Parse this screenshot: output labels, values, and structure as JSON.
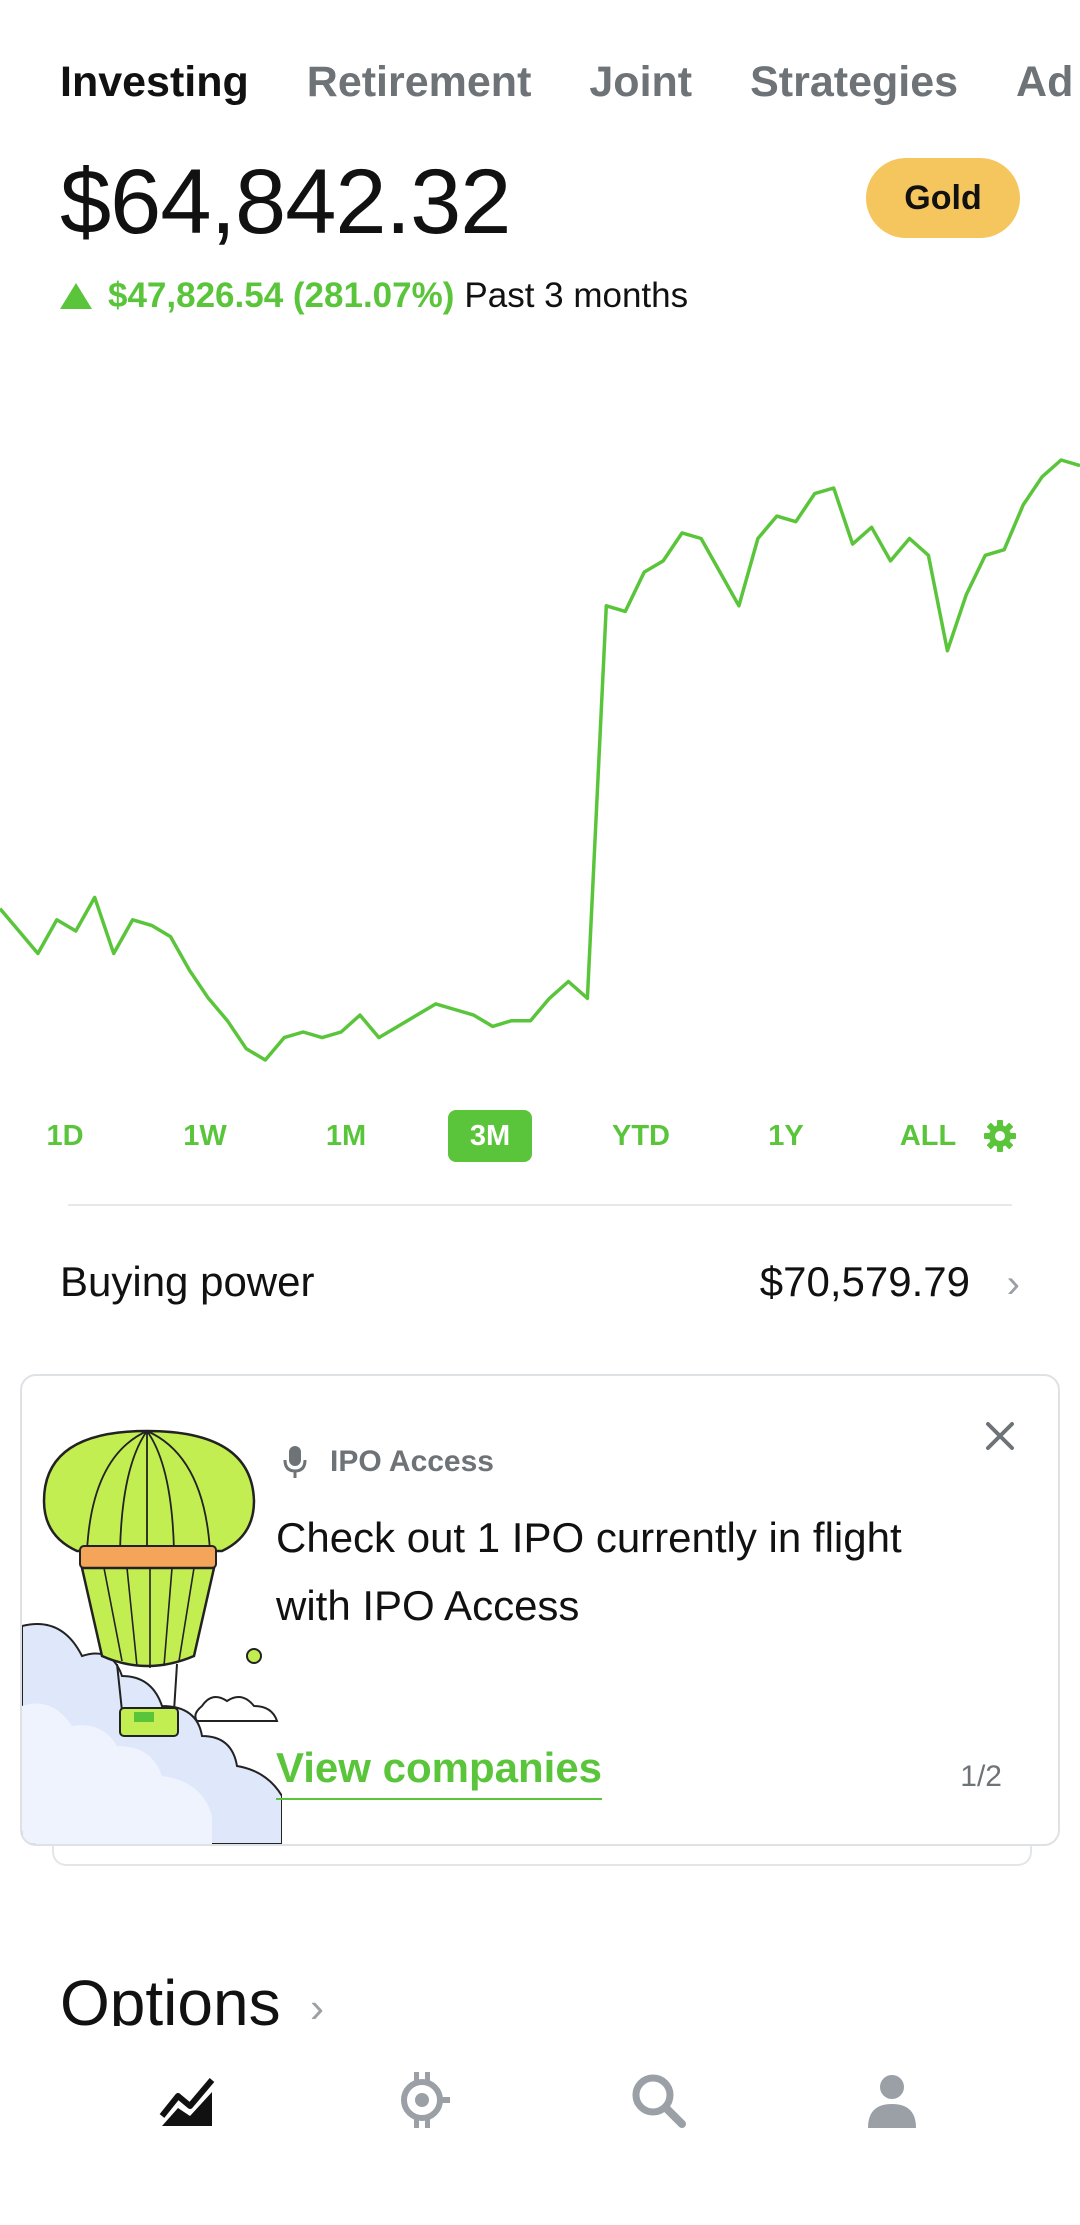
{
  "tabs": [
    {
      "label": "Investing",
      "active": true
    },
    {
      "label": "Retirement",
      "active": false
    },
    {
      "label": "Joint",
      "active": false
    },
    {
      "label": "Strategies",
      "active": false
    },
    {
      "label": "Ad",
      "active": false
    }
  ],
  "portfolio": {
    "balance": "$64,842.32",
    "badge": "Gold",
    "gain_amount": "$47,826.54 (281.07%)",
    "gain_period": "Past 3 months"
  },
  "chart_data": {
    "type": "line",
    "color": "#5ac53b",
    "grid": false,
    "values": [
      62,
      60,
      58,
      61,
      60,
      63,
      58,
      61,
      60.5,
      59.5,
      56.5,
      54,
      52,
      49.5,
      48.5,
      50.5,
      51,
      50.5,
      51,
      52.5,
      50.5,
      51.5,
      52.5,
      53.5,
      53,
      52.5,
      51.5,
      52,
      52,
      54,
      55.5,
      54,
      89,
      88.5,
      92,
      93,
      95.5,
      95,
      92,
      89,
      95,
      97,
      96.5,
      99,
      99.5,
      94.5,
      96,
      93,
      95,
      93.5,
      85,
      90,
      93.5,
      94,
      98,
      100.5,
      102,
      101.5
    ]
  },
  "ranges": [
    {
      "label": "1D",
      "active": false
    },
    {
      "label": "1W",
      "active": false
    },
    {
      "label": "1M",
      "active": false
    },
    {
      "label": "3M",
      "active": true
    },
    {
      "label": "YTD",
      "active": false
    },
    {
      "label": "1Y",
      "active": false
    },
    {
      "label": "ALL",
      "active": false
    }
  ],
  "buying_power": {
    "label": "Buying power",
    "value": "$70,579.79"
  },
  "ipo_card": {
    "tag": "IPO Access",
    "body": "Check out 1 IPO currently in flight with IPO Access",
    "link": "View companies",
    "count": "1/2"
  },
  "options": {
    "title": "Options"
  },
  "nav": [
    "investing-chart-icon",
    "crypto-icon",
    "search-icon",
    "profile-icon"
  ],
  "colors": {
    "accent": "#5ac53b",
    "badge": "#f5c65e"
  }
}
